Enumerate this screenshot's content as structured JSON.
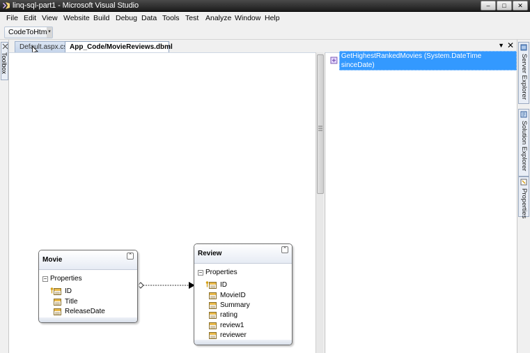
{
  "window": {
    "title": "linq-sql-part1 - Microsoft Visual Studio",
    "controls": {
      "minimize": "–",
      "maximize": "□",
      "close": "✕"
    }
  },
  "menu": [
    "File",
    "Edit",
    "View",
    "Website",
    "Build",
    "Debug",
    "Data",
    "Tools",
    "Test",
    "Analyze",
    "Window",
    "Help"
  ],
  "toolbar": {
    "code_to_html_label": "CodeToHtml",
    "dropdown_glyph": "▾"
  },
  "tabs": [
    {
      "label": "Default.aspx.cs",
      "active": false
    },
    {
      "label": "App_Code/MovieReviews.dbml",
      "active": true
    }
  ],
  "tab_controls": {
    "menu_glyph": "▼",
    "close_glyph": "✕"
  },
  "side_tabs": {
    "left": {
      "label": "Toolbox"
    },
    "right": [
      {
        "label": "Server Explorer"
      },
      {
        "label": "Solution Explorer"
      },
      {
        "label": "Properties"
      }
    ]
  },
  "methods_pane": {
    "items": [
      {
        "label": "GetHighestRankedMovies (System.DateTime sinceDate)",
        "selected": true
      }
    ]
  },
  "entities": [
    {
      "name": "Movie",
      "section_label": "Properties",
      "properties": [
        {
          "name": "ID",
          "primary_key": true
        },
        {
          "name": "Title",
          "primary_key": false
        },
        {
          "name": "ReleaseDate",
          "primary_key": false
        }
      ]
    },
    {
      "name": "Review",
      "section_label": "Properties",
      "properties": [
        {
          "name": "ID",
          "primary_key": true
        },
        {
          "name": "MovieID",
          "primary_key": false
        },
        {
          "name": "Summary",
          "primary_key": false
        },
        {
          "name": "rating",
          "primary_key": false
        },
        {
          "name": "review1",
          "primary_key": false
        },
        {
          "name": "reviewer",
          "primary_key": false
        }
      ]
    }
  ],
  "colors": {
    "selection": "#3399ff",
    "titlebar": "#1c1c1c",
    "chrome": "#f0f0f0",
    "entity_header": "#e6ebf4"
  }
}
